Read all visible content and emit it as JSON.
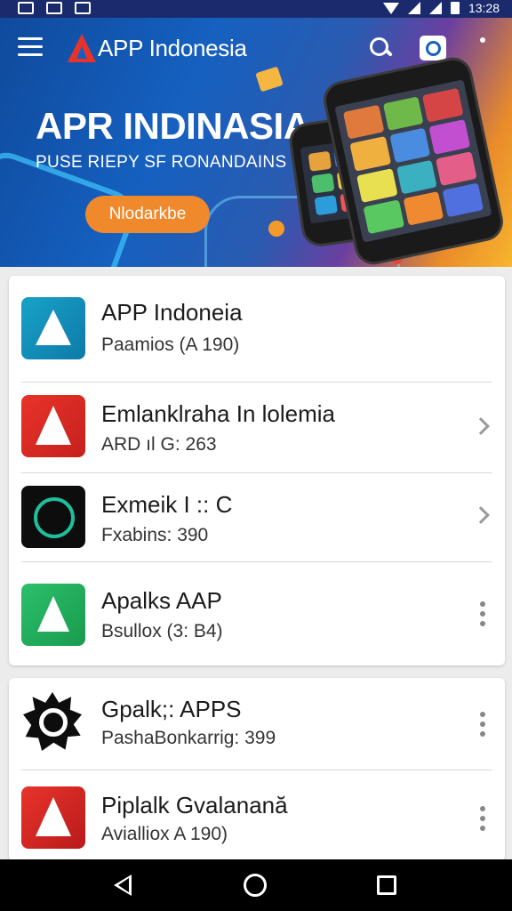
{
  "status_bar": {
    "time": "13:28"
  },
  "header": {
    "brand": "APP Indonesia",
    "hero_title": "APR INDINASIA",
    "hero_subtitle": "PUSE RIEPY SF RONANDAINS",
    "hero_button": "Nlodarkbe"
  },
  "apps_card1": [
    {
      "name": "APP Indoneia",
      "meta": "Paamios (A 190)",
      "action": "none"
    },
    {
      "name": "Emlanklraha In lolemia",
      "meta": "ARD ıl G: 263",
      "action": "chevron"
    },
    {
      "name": "Exmeik I :: C",
      "meta": "Fxabins: 390",
      "action": "chevron"
    },
    {
      "name": "Apalks AAP",
      "meta": "Bsullox (3: B4)",
      "action": "more"
    }
  ],
  "apps_card2": [
    {
      "name": "Gpalk;: APPS",
      "meta": "PashaBonkarrig: 399",
      "action": "more"
    },
    {
      "name": "Piplalk Gvalanană",
      "meta": "Avialliox A 190)",
      "action": "more"
    }
  ],
  "colors": {
    "status_bar": "#1a2a6c",
    "hero_start": "#0f4a9c",
    "hero_end": "#f7b52d",
    "accent_button": "#f0892c",
    "brand_red": "#e8332a"
  },
  "icons": {
    "toolbar": [
      "menu-icon",
      "search-icon",
      "camera-icon"
    ],
    "nav": [
      "back-icon",
      "home-icon",
      "recents-icon"
    ]
  }
}
